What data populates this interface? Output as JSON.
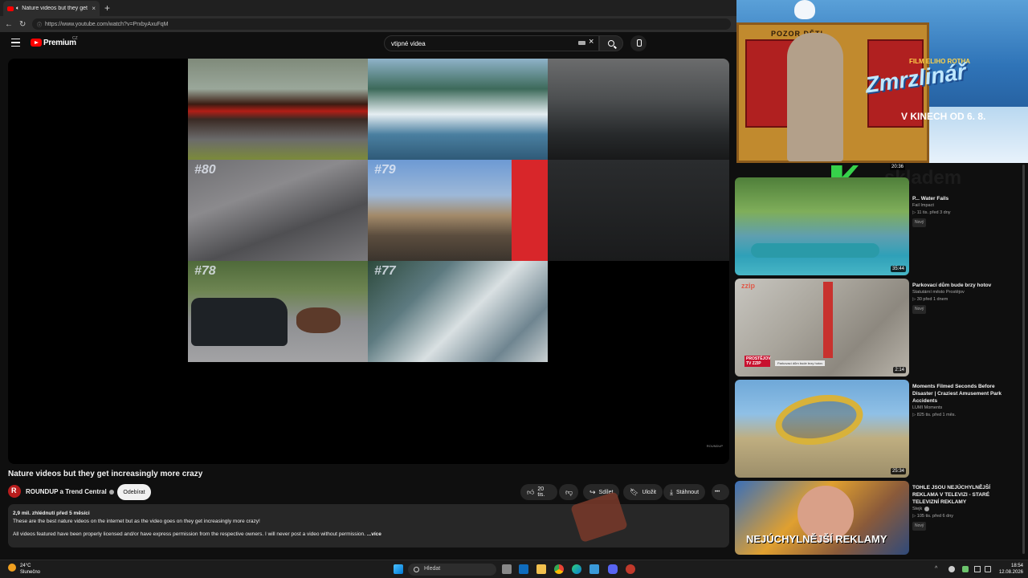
{
  "browser": {
    "tab_title": "Nature videos but they get in",
    "tab_close": "×",
    "new_tab": "+",
    "url": "https://www.youtube.com/watch?v=PrxbyAxuFqM"
  },
  "header": {
    "logo_text": "Premium",
    "region": "CZ",
    "search_value": "vtipné videa",
    "clear": "×"
  },
  "player": {
    "tiles": [
      "#80",
      "#79",
      "#78",
      "#77"
    ],
    "watermark": "ROUNDUP"
  },
  "video": {
    "title": "Nature videos but they get increasingly more crazy",
    "channel": "ROUNDUP a Trend Central",
    "subscribe": "Odebírat",
    "likes": "20 tis.",
    "share": "Sdílet",
    "save": "Uložit",
    "download": "Stáhnout",
    "more": "•••",
    "meta": "2,9 mil. zhlédnutí  před 5 měsíci",
    "desc1": "These are the best nature videos on the internet but as the video goes on they get increasingly more crazy!",
    "desc2": "All videos featured have been properly licensed and/or have express permission from the respective owners. I will never post a video without permission.",
    "desc_more": "...více"
  },
  "ad": {
    "pozor": "POZOR DĚTI",
    "film": "FILM ELIHO ROTHA",
    "title": "Zmrzlinář",
    "date": "V KINECH OD 6. 8.",
    "overlay": "skladem"
  },
  "recommendations": [
    {
      "title": "P... Water Fails",
      "channel": "Fail Impact",
      "meta": "▷ 11 tis.  před 3 dny",
      "badge": "Nový",
      "duration": "35:44",
      "top_duration": "20:36"
    },
    {
      "title": "Parkovací dům bude brzy hotov",
      "channel": "Statutární město Prostějov",
      "meta": "▷ 30  před 1 dnem",
      "badge": "Nový",
      "duration": "2:14",
      "caption1": "PROSTĚJOV TV ZZIP",
      "caption2": "Parkovací dům bude brzy hotov",
      "logo": "zzip"
    },
    {
      "title": "Moments Filmed Seconds Before Disaster | Craziest Amusement Park Accidents",
      "channel": "LUMI Moments",
      "meta": "▷ 825 tis.  před 1 měs.",
      "badge": "",
      "duration": "25:34"
    },
    {
      "title": "TOHLE JSOU NEJÚCHYLNĚJŠÍ REKLAMA V TELEVIZI - STARÉ TELEVIZNÍ REKLAMY",
      "channel": "Stejk",
      "meta": "▷ 105 tis.  před 6 dny",
      "badge": "Nový",
      "duration": "",
      "thumb_text": "NEJÚCHYLNĚJŠÍ REKLAMY"
    }
  ],
  "taskbar": {
    "temp": "24°C",
    "weather": "Slunečno",
    "search": "Hledat",
    "time": "18:54",
    "date": "12.08.2026"
  }
}
